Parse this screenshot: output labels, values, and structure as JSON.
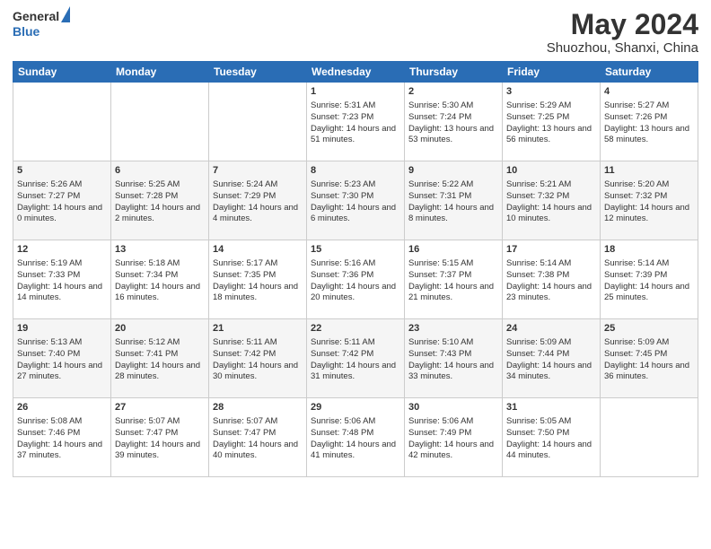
{
  "header": {
    "logo_line1": "General",
    "logo_line2": "Blue",
    "title": "May 2024",
    "location": "Shuozhou, Shanxi, China"
  },
  "days_of_week": [
    "Sunday",
    "Monday",
    "Tuesday",
    "Wednesday",
    "Thursday",
    "Friday",
    "Saturday"
  ],
  "weeks": [
    [
      {
        "day": "",
        "sunrise": "",
        "sunset": "",
        "daylight": ""
      },
      {
        "day": "",
        "sunrise": "",
        "sunset": "",
        "daylight": ""
      },
      {
        "day": "",
        "sunrise": "",
        "sunset": "",
        "daylight": ""
      },
      {
        "day": "1",
        "sunrise": "Sunrise: 5:31 AM",
        "sunset": "Sunset: 7:23 PM",
        "daylight": "Daylight: 14 hours and 51 minutes."
      },
      {
        "day": "2",
        "sunrise": "Sunrise: 5:30 AM",
        "sunset": "Sunset: 7:24 PM",
        "daylight": "Daylight: 13 hours and 53 minutes."
      },
      {
        "day": "3",
        "sunrise": "Sunrise: 5:29 AM",
        "sunset": "Sunset: 7:25 PM",
        "daylight": "Daylight: 13 hours and 56 minutes."
      },
      {
        "day": "4",
        "sunrise": "Sunrise: 5:27 AM",
        "sunset": "Sunset: 7:26 PM",
        "daylight": "Daylight: 13 hours and 58 minutes."
      }
    ],
    [
      {
        "day": "5",
        "sunrise": "Sunrise: 5:26 AM",
        "sunset": "Sunset: 7:27 PM",
        "daylight": "Daylight: 14 hours and 0 minutes."
      },
      {
        "day": "6",
        "sunrise": "Sunrise: 5:25 AM",
        "sunset": "Sunset: 7:28 PM",
        "daylight": "Daylight: 14 hours and 2 minutes."
      },
      {
        "day": "7",
        "sunrise": "Sunrise: 5:24 AM",
        "sunset": "Sunset: 7:29 PM",
        "daylight": "Daylight: 14 hours and 4 minutes."
      },
      {
        "day": "8",
        "sunrise": "Sunrise: 5:23 AM",
        "sunset": "Sunset: 7:30 PM",
        "daylight": "Daylight: 14 hours and 6 minutes."
      },
      {
        "day": "9",
        "sunrise": "Sunrise: 5:22 AM",
        "sunset": "Sunset: 7:31 PM",
        "daylight": "Daylight: 14 hours and 8 minutes."
      },
      {
        "day": "10",
        "sunrise": "Sunrise: 5:21 AM",
        "sunset": "Sunset: 7:32 PM",
        "daylight": "Daylight: 14 hours and 10 minutes."
      },
      {
        "day": "11",
        "sunrise": "Sunrise: 5:20 AM",
        "sunset": "Sunset: 7:32 PM",
        "daylight": "Daylight: 14 hours and 12 minutes."
      }
    ],
    [
      {
        "day": "12",
        "sunrise": "Sunrise: 5:19 AM",
        "sunset": "Sunset: 7:33 PM",
        "daylight": "Daylight: 14 hours and 14 minutes."
      },
      {
        "day": "13",
        "sunrise": "Sunrise: 5:18 AM",
        "sunset": "Sunset: 7:34 PM",
        "daylight": "Daylight: 14 hours and 16 minutes."
      },
      {
        "day": "14",
        "sunrise": "Sunrise: 5:17 AM",
        "sunset": "Sunset: 7:35 PM",
        "daylight": "Daylight: 14 hours and 18 minutes."
      },
      {
        "day": "15",
        "sunrise": "Sunrise: 5:16 AM",
        "sunset": "Sunset: 7:36 PM",
        "daylight": "Daylight: 14 hours and 20 minutes."
      },
      {
        "day": "16",
        "sunrise": "Sunrise: 5:15 AM",
        "sunset": "Sunset: 7:37 PM",
        "daylight": "Daylight: 14 hours and 21 minutes."
      },
      {
        "day": "17",
        "sunrise": "Sunrise: 5:14 AM",
        "sunset": "Sunset: 7:38 PM",
        "daylight": "Daylight: 14 hours and 23 minutes."
      },
      {
        "day": "18",
        "sunrise": "Sunrise: 5:14 AM",
        "sunset": "Sunset: 7:39 PM",
        "daylight": "Daylight: 14 hours and 25 minutes."
      }
    ],
    [
      {
        "day": "19",
        "sunrise": "Sunrise: 5:13 AM",
        "sunset": "Sunset: 7:40 PM",
        "daylight": "Daylight: 14 hours and 27 minutes."
      },
      {
        "day": "20",
        "sunrise": "Sunrise: 5:12 AM",
        "sunset": "Sunset: 7:41 PM",
        "daylight": "Daylight: 14 hours and 28 minutes."
      },
      {
        "day": "21",
        "sunrise": "Sunrise: 5:11 AM",
        "sunset": "Sunset: 7:42 PM",
        "daylight": "Daylight: 14 hours and 30 minutes."
      },
      {
        "day": "22",
        "sunrise": "Sunrise: 5:11 AM",
        "sunset": "Sunset: 7:42 PM",
        "daylight": "Daylight: 14 hours and 31 minutes."
      },
      {
        "day": "23",
        "sunrise": "Sunrise: 5:10 AM",
        "sunset": "Sunset: 7:43 PM",
        "daylight": "Daylight: 14 hours and 33 minutes."
      },
      {
        "day": "24",
        "sunrise": "Sunrise: 5:09 AM",
        "sunset": "Sunset: 7:44 PM",
        "daylight": "Daylight: 14 hours and 34 minutes."
      },
      {
        "day": "25",
        "sunrise": "Sunrise: 5:09 AM",
        "sunset": "Sunset: 7:45 PM",
        "daylight": "Daylight: 14 hours and 36 minutes."
      }
    ],
    [
      {
        "day": "26",
        "sunrise": "Sunrise: 5:08 AM",
        "sunset": "Sunset: 7:46 PM",
        "daylight": "Daylight: 14 hours and 37 minutes."
      },
      {
        "day": "27",
        "sunrise": "Sunrise: 5:07 AM",
        "sunset": "Sunset: 7:47 PM",
        "daylight": "Daylight: 14 hours and 39 minutes."
      },
      {
        "day": "28",
        "sunrise": "Sunrise: 5:07 AM",
        "sunset": "Sunset: 7:47 PM",
        "daylight": "Daylight: 14 hours and 40 minutes."
      },
      {
        "day": "29",
        "sunrise": "Sunrise: 5:06 AM",
        "sunset": "Sunset: 7:48 PM",
        "daylight": "Daylight: 14 hours and 41 minutes."
      },
      {
        "day": "30",
        "sunrise": "Sunrise: 5:06 AM",
        "sunset": "Sunset: 7:49 PM",
        "daylight": "Daylight: 14 hours and 42 minutes."
      },
      {
        "day": "31",
        "sunrise": "Sunrise: 5:05 AM",
        "sunset": "Sunset: 7:50 PM",
        "daylight": "Daylight: 14 hours and 44 minutes."
      },
      {
        "day": "",
        "sunrise": "",
        "sunset": "",
        "daylight": ""
      }
    ]
  ]
}
